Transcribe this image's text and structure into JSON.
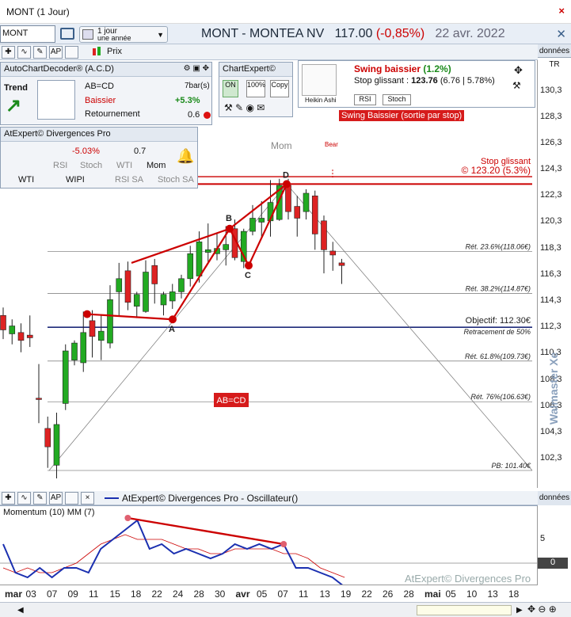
{
  "window": {
    "title": "MONT (1 Jour)",
    "close": "×"
  },
  "infobar": {
    "symbol": "MONT",
    "period_line1": "1 jour",
    "period_line2": "une année",
    "instrument": "MONT - MONTEA NV",
    "price": "117.00",
    "change": "(-0,85%)",
    "date": "22 avr. 2022"
  },
  "toolbar": {
    "price_label": "Prix",
    "data_label": "données TR"
  },
  "acd_panel": {
    "title": "AutoChartDecoder® (A.C.D)",
    "trend_label": "Trend",
    "pattern": "AB=CD",
    "direction": "Baissier",
    "type": "Retournement",
    "bars": "7bar(s)",
    "pct": "+5.3%",
    "score": "0.6"
  },
  "chartexpert": {
    "title": "ChartExpert©",
    "on": "ON",
    "pct100": "100%",
    "copy": "Copy"
  },
  "swing": {
    "title": "Swing baissier",
    "pct": "(1.2%)",
    "stop_label": "Stop glissant :",
    "stop_value": "123.76",
    "stop_detail": "(6.76 | 5.78%)",
    "heikin": "Heikin Ashi",
    "rsi": "RSI",
    "stoch": "Stoch",
    "banner": "Swing Baissier (sortie par stop)"
  },
  "divergences": {
    "title": "AtExpert© Divergences Pro",
    "pct": "-5.03%",
    "value": "0.7",
    "rsi": "RSI",
    "stoch": "Stoch",
    "wti": "WTI",
    "mom": "Mom",
    "wti2": "WTI",
    "wipi": "WIPI",
    "rsi_sa": "RSI SA",
    "stoch_sa": "Stoch SA"
  },
  "annotations": {
    "mom": "Mom",
    "bear": "Bear",
    "stop_glissant": "Stop glissant",
    "stop_value": "© 123.20 (5.3%)",
    "ret236": "Rét. 23.6%(118.06€)",
    "ret382": "Rét. 38.2%(114.87€)",
    "objectif": "Objectif: 112.30€",
    "retr50": "Retracement de 50%",
    "ret618": "Rét. 61.8%(109.73€)",
    "ret76": "Rét. 76%(106.63€)",
    "pb": "PB: 101.40€",
    "abcd_box": "AB=CD",
    "pt_a": "A",
    "pt_b": "B",
    "pt_c": "C",
    "pt_d": "D"
  },
  "price_axis": [
    "130,3",
    "128,3",
    "126,3",
    "124,3",
    "122,3",
    "120,3",
    "118,3",
    "116,3",
    "114,3",
    "112,3",
    "110,3",
    "108,3",
    "106,3",
    "104,3",
    "102,3"
  ],
  "oscillator": {
    "title": "AtExpert© Divergences Pro - Oscillateur()",
    "label": "Momentum (10) MM (7)",
    "watermark": "AtExpert© Divergences Pro",
    "axis_5": "5",
    "axis_0": "0",
    "data_label": "données TR"
  },
  "watermark_side": "Walmaster Xe",
  "dates": [
    "mar",
    "03",
    "07",
    "09",
    "11",
    "15",
    "18",
    "22",
    "24",
    "28",
    "30",
    "avr",
    "05",
    "07",
    "11",
    "13",
    "19",
    "22",
    "26",
    "28",
    "mai",
    "05",
    "10",
    "13",
    "18"
  ],
  "colors": {
    "up": "#22aa22",
    "down": "#dd2222",
    "line": "#cc0000",
    "osc": "#1a2fb0",
    "navy": "#1e2a7a"
  },
  "chart_data": {
    "type": "candlestick",
    "candles": [
      {
        "o": 113.2,
        "h": 113.8,
        "l": 111.4,
        "c": 112.1
      },
      {
        "o": 111.8,
        "h": 112.9,
        "l": 111.0,
        "c": 112.4
      },
      {
        "o": 111.9,
        "h": 112.6,
        "l": 110.4,
        "c": 111.3
      },
      {
        "o": 111.7,
        "h": 113.2,
        "l": 110.8,
        "c": 111.5
      },
      {
        "o": 106.9,
        "h": 109.5,
        "l": 105.0,
        "c": 106.8
      },
      {
        "o": 104.6,
        "h": 105.5,
        "l": 101.6,
        "c": 103.2
      },
      {
        "o": 101.8,
        "h": 105.8,
        "l": 100.8,
        "c": 104.9
      },
      {
        "o": 106.5,
        "h": 111.0,
        "l": 106.0,
        "c": 110.5
      },
      {
        "o": 109.8,
        "h": 111.3,
        "l": 109.4,
        "c": 111.1
      },
      {
        "o": 109.6,
        "h": 113.5,
        "l": 108.9,
        "c": 111.9
      },
      {
        "o": 112.8,
        "h": 113.6,
        "l": 110.0,
        "c": 111.6
      },
      {
        "o": 111.3,
        "h": 113.2,
        "l": 109.8,
        "c": 112.0
      },
      {
        "o": 111.1,
        "h": 115.5,
        "l": 110.7,
        "c": 114.4
      },
      {
        "o": 115.0,
        "h": 117.2,
        "l": 113.1,
        "c": 116.0
      },
      {
        "o": 116.6,
        "h": 117.3,
        "l": 113.6,
        "c": 114.2
      },
      {
        "o": 113.9,
        "h": 115.0,
        "l": 113.0,
        "c": 114.8
      },
      {
        "o": 113.5,
        "h": 117.4,
        "l": 113.4,
        "c": 116.5
      },
      {
        "o": 117.0,
        "h": 117.5,
        "l": 114.1,
        "c": 115.6
      },
      {
        "o": 114.0,
        "h": 115.0,
        "l": 113.2,
        "c": 114.8
      },
      {
        "o": 114.3,
        "h": 115.6,
        "l": 113.7,
        "c": 115.0
      },
      {
        "o": 115.0,
        "h": 116.3,
        "l": 114.5,
        "c": 116.0
      },
      {
        "o": 116.0,
        "h": 118.5,
        "l": 115.4,
        "c": 117.9
      },
      {
        "o": 116.2,
        "h": 119.6,
        "l": 115.7,
        "c": 118.8
      },
      {
        "o": 118.0,
        "h": 120.2,
        "l": 117.2,
        "c": 118.2
      },
      {
        "o": 117.9,
        "h": 119.5,
        "l": 117.4,
        "c": 118.3
      },
      {
        "o": 118.2,
        "h": 120.0,
        "l": 117.0,
        "c": 118.6
      },
      {
        "o": 119.8,
        "h": 120.5,
        "l": 117.4,
        "c": 117.6
      },
      {
        "o": 117.3,
        "h": 119.8,
        "l": 116.8,
        "c": 119.6
      },
      {
        "o": 119.6,
        "h": 121.6,
        "l": 119.3,
        "c": 120.6
      },
      {
        "o": 120.3,
        "h": 121.9,
        "l": 119.2,
        "c": 120.6
      },
      {
        "o": 120.4,
        "h": 123.5,
        "l": 119.2,
        "c": 121.8
      },
      {
        "o": 120.5,
        "h": 123.6,
        "l": 120.4,
        "c": 123.1
      },
      {
        "o": 123.1,
        "h": 123.6,
        "l": 120.5,
        "c": 121.1
      },
      {
        "o": 121.5,
        "h": 122.3,
        "l": 119.2,
        "c": 120.6
      },
      {
        "o": 121.1,
        "h": 122.8,
        "l": 120.5,
        "c": 122.5
      },
      {
        "o": 122.3,
        "h": 122.7,
        "l": 118.2,
        "c": 119.4
      },
      {
        "o": 120.4,
        "h": 120.8,
        "l": 116.4,
        "c": 118.2
      },
      {
        "o": 118.1,
        "h": 118.8,
        "l": 116.6,
        "c": 117.8
      },
      {
        "o": 117.2,
        "h": 117.5,
        "l": 115.6,
        "c": 117.0
      }
    ],
    "pattern_points": {
      "X": 113.3,
      "A": 112.9,
      "B": 119.8,
      "C": 117.0,
      "D": 123.2
    },
    "levels": [
      118.06,
      114.87,
      112.3,
      109.73,
      106.63,
      101.4,
      123.2,
      123.76
    ],
    "oscillator_momentum": [
      4,
      -2,
      -3,
      -1,
      -3,
      -1,
      -1,
      -2,
      3,
      5,
      7,
      9,
      3,
      4,
      2,
      3,
      2,
      1,
      2,
      4,
      3,
      4,
      3,
      4,
      -1,
      -1,
      -2,
      -3,
      -5
    ],
    "oscillator_ma": [
      -1,
      -2,
      -1,
      -2,
      -2,
      -1,
      0,
      2,
      4,
      5,
      6,
      5,
      5,
      5,
      4,
      3,
      3,
      2,
      2,
      3,
      3,
      3,
      3,
      2,
      2,
      1,
      -1,
      -2,
      -3
    ],
    "y_axis_range": [
      101.4,
      131.3
    ]
  }
}
